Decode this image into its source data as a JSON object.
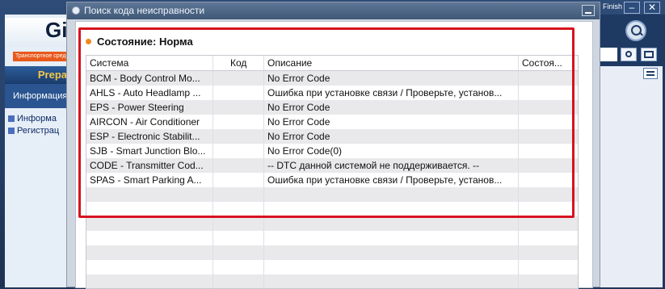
{
  "background_app": {
    "logo_text": "Gi",
    "banner_text": "Транспортное средство: Н…",
    "section_title": "Prepa",
    "info_tab": "Информация об",
    "tree_items": [
      "Информа",
      "Регистрац"
    ],
    "finish_label": "Finish",
    "window_controls": [
      "minimize-icon",
      "close-icon"
    ],
    "toolbar_icons": [
      "search-icon",
      "camera-icon",
      "grid-icon",
      "list-icon"
    ]
  },
  "dialog": {
    "title": "Поиск кода неисправности",
    "status_label": "Состояние: Норма",
    "status_color": "#f08a1c",
    "columns": [
      "Система",
      "Код",
      "Описание",
      "Состоя..."
    ],
    "rows": [
      {
        "system": "BCM - Body Control Mo...",
        "code": "",
        "description": "No Error Code",
        "state": ""
      },
      {
        "system": "AHLS - Auto Headlamp ...",
        "code": "",
        "description": "Ошибка при установке связи / Проверьте, установ...",
        "state": ""
      },
      {
        "system": "EPS - Power Steering",
        "code": "",
        "description": "No Error Code",
        "state": ""
      },
      {
        "system": "AIRCON - Air Conditioner",
        "code": "",
        "description": "No Error Code",
        "state": ""
      },
      {
        "system": "ESP - Electronic Stabilit...",
        "code": "",
        "description": "No Error Code",
        "state": ""
      },
      {
        "system": "SJB - Smart Junction Blo...",
        "code": "",
        "description": "No Error Code(0)",
        "state": ""
      },
      {
        "system": "CODE - Transmitter Cod...",
        "code": "",
        "description": "-- DTC данной системой не поддерживается. --",
        "state": ""
      },
      {
        "system": "SPAS - Smart Parking A...",
        "code": "",
        "description": "Ошибка при установке связи / Проверьте, установ...",
        "state": ""
      }
    ],
    "highlight_color": "#d7131f"
  }
}
